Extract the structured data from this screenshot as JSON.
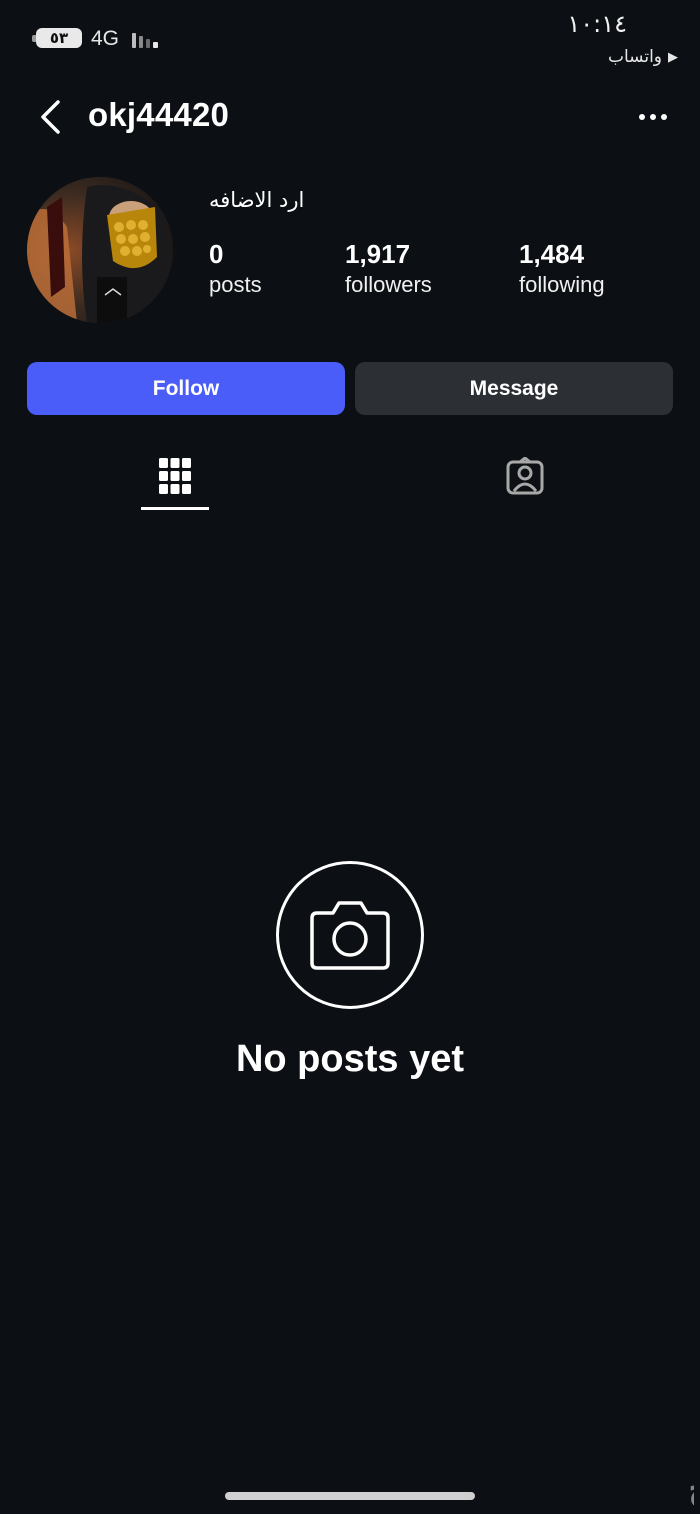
{
  "status_bar": {
    "battery": "٥٣",
    "network": "4G",
    "time": "١٠:١٤",
    "back_to_app": "واتساب",
    "back_arrow": "▶",
    "signal_icon": "cellular-signal-icon"
  },
  "header": {
    "back_icon": "chevron-left-icon",
    "username": "okj44420",
    "more_icon": "more-horizontal-icon"
  },
  "profile": {
    "display_name": "ارد الاضافه",
    "stats": [
      {
        "value": "0",
        "label": "posts"
      },
      {
        "value": "1,917",
        "label": "followers"
      },
      {
        "value": "1,484",
        "label": "following"
      }
    ]
  },
  "actions": {
    "follow_label": "Follow",
    "message_label": "Message",
    "follow_color": "#4a5df9",
    "message_color": "#2c3035"
  },
  "tabs": [
    {
      "icon": "grid-icon",
      "active": true
    },
    {
      "icon": "tagged-person-icon",
      "active": false
    }
  ],
  "empty_state": {
    "icon": "camera-icon",
    "title": "No posts yet"
  },
  "watermark": {
    "text": "حراج"
  }
}
